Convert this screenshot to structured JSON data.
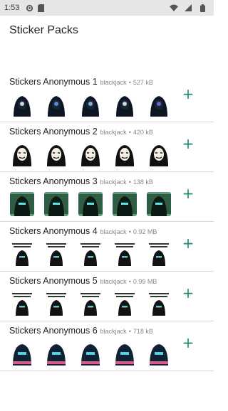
{
  "status": {
    "time": "1:53",
    "left_icons": [
      "gear-icon",
      "sim-card-icon"
    ],
    "right_icons": [
      "wifi-icon",
      "signal-icon",
      "battery-icon"
    ]
  },
  "app": {
    "title": "Sticker Packs"
  },
  "packs": [
    {
      "name": "Stickers Anonymous 1",
      "author": "blackjack",
      "size": "527 kB",
      "style": "hood"
    },
    {
      "name": "Stickers Anonymous 2",
      "author": "blackjack",
      "size": "420 kB",
      "style": "mask"
    },
    {
      "name": "Stickers Anonymous 3",
      "author": "blackjack",
      "size": "138 kB",
      "style": "green"
    },
    {
      "name": "Stickers Anonymous 4",
      "author": "blackjack",
      "size": "0.92 MB",
      "style": "text"
    },
    {
      "name": "Stickers Anonymous 5",
      "author": "blackjack",
      "size": "0.99 MB",
      "style": "text"
    },
    {
      "name": "Stickers Anonymous 6",
      "author": "blackjack",
      "size": "718 kB",
      "style": "pink"
    }
  ],
  "separator": "•",
  "add_icon": "+",
  "colors": {
    "accent": "#1e8a74",
    "status_bar": "#e6e6e6",
    "divider": "#d9d9d9"
  }
}
